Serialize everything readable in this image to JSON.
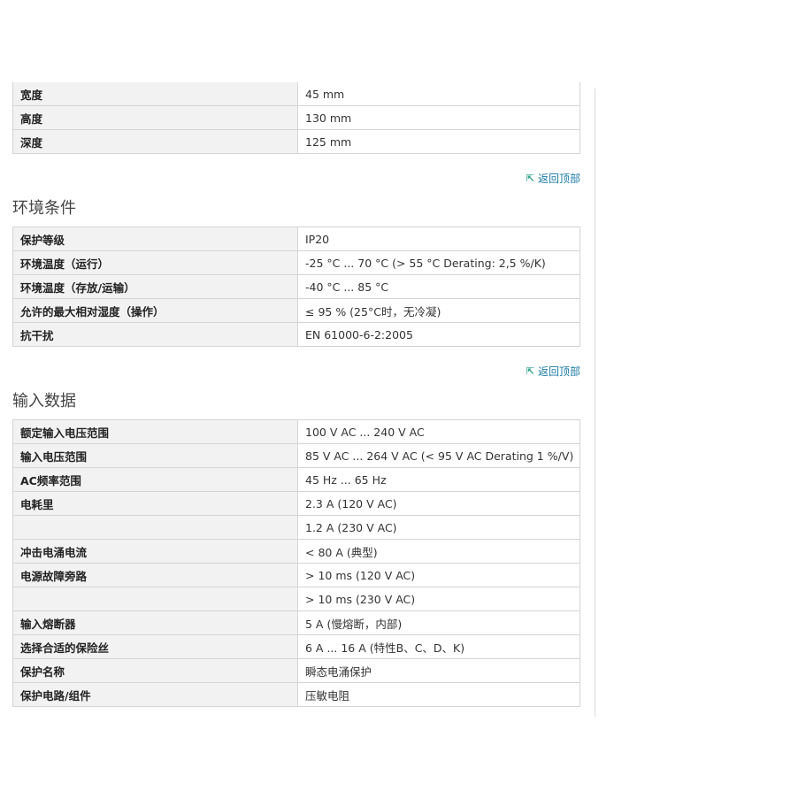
{
  "dimensions": {
    "rows": [
      {
        "label": "宽度",
        "value": "45 mm"
      },
      {
        "label": "高度",
        "value": "130 mm"
      },
      {
        "label": "深度",
        "value": "125 mm"
      }
    ]
  },
  "back_to_top": {
    "label": "返回顶部",
    "icon": "arrow-up-left-icon"
  },
  "environment": {
    "title": "环境条件",
    "rows": [
      {
        "label": "保护等级",
        "value": "IP20"
      },
      {
        "label": "环境温度（运行）",
        "value": "-25 °C ... 70 °C (> 55 °C Derating: 2,5 %/K)"
      },
      {
        "label": "环境温度（存放/运输）",
        "value": "-40 °C ... 85 °C"
      },
      {
        "label": "允许的最大相对湿度（操作）",
        "value": "≤ 95 % (25°C时，无冷凝)"
      },
      {
        "label": "抗干扰",
        "value": "EN 61000-6-2:2005"
      }
    ]
  },
  "input": {
    "title": "输入数据",
    "rows": [
      {
        "label": "额定输入电压范围",
        "value": "100 V AC ... 240 V AC"
      },
      {
        "label": "输入电压范围",
        "value": "85 V AC ... 264 V AC (< 95 V AC Derating 1 %/V)"
      },
      {
        "label": "AC频率范围",
        "value": "45 Hz ... 65 Hz"
      },
      {
        "label": "电耗里",
        "value": "2.3 A (120 V AC)"
      },
      {
        "label": "",
        "value": "1.2 A (230 V AC)"
      },
      {
        "label": "冲击电涌电流",
        "value": "< 80 A (典型)"
      },
      {
        "label": "电源故障旁路",
        "value": "> 10 ms (120 V AC)"
      },
      {
        "label": "",
        "value": "> 10 ms (230 V AC)"
      },
      {
        "label": "输入熔断器",
        "value": "5 A (慢熔断，内部)"
      },
      {
        "label": "选择合适的保险丝",
        "value": "6 A ... 16 A (特性B、C、D、K)"
      },
      {
        "label": "保护名称",
        "value": "瞬态电涌保护"
      },
      {
        "label": "保护电路/组件",
        "value": "压敏电阻"
      }
    ]
  }
}
